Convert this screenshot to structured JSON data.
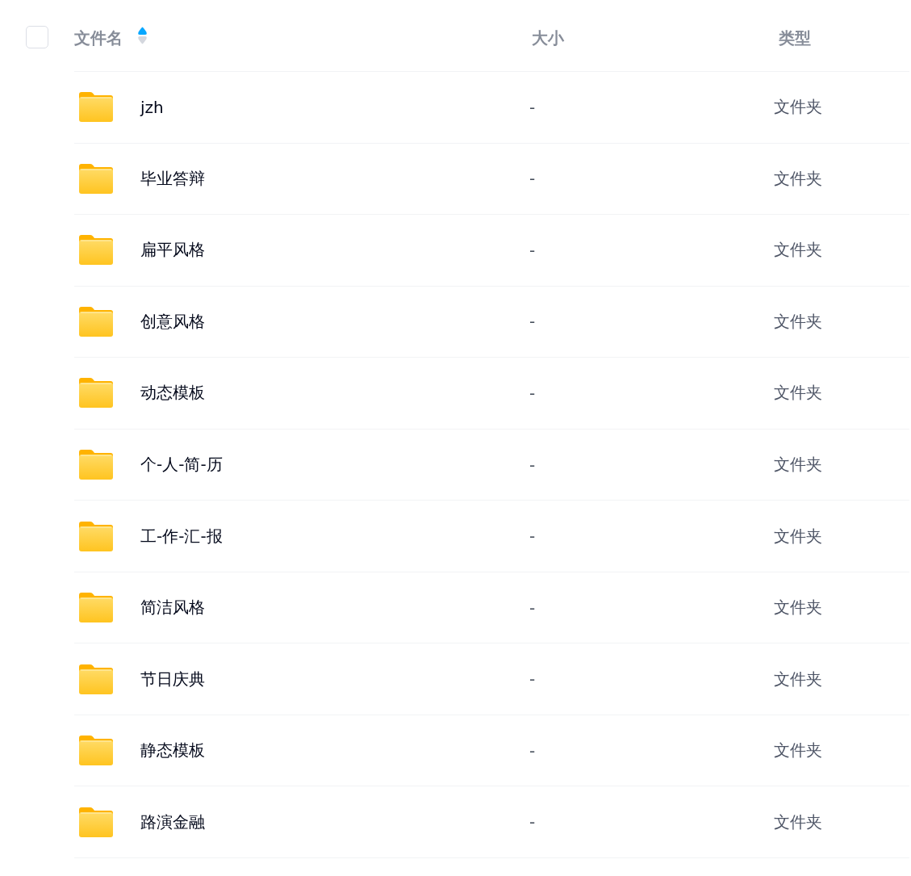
{
  "select_all": {
    "checked": false
  },
  "columns": [
    {
      "label": "文件名",
      "sorted": true,
      "ascending": true
    },
    {
      "label": "大小",
      "sorted": false
    },
    {
      "label": "类型",
      "sorted": false
    }
  ],
  "rows": [
    {
      "name": "jzh",
      "size": "-",
      "type": "文件夹"
    },
    {
      "name": "毕业答辩",
      "size": "-",
      "type": "文件夹"
    },
    {
      "name": "扁平风格",
      "size": "-",
      "type": "文件夹"
    },
    {
      "name": "创意风格",
      "size": "-",
      "type": "文件夹"
    },
    {
      "name": "动态模板",
      "size": "-",
      "type": "文件夹"
    },
    {
      "name": "个-人-简-历",
      "size": "-",
      "type": "文件夹"
    },
    {
      "name": "工-作-汇-报",
      "size": "-",
      "type": "文件夹"
    },
    {
      "name": "简洁风格",
      "size": "-",
      "type": "文件夹"
    },
    {
      "name": "节日庆典",
      "size": "-",
      "type": "文件夹"
    },
    {
      "name": "静态模板",
      "size": "-",
      "type": "文件夹"
    },
    {
      "name": "路演金融",
      "size": "-",
      "type": "文件夹"
    }
  ]
}
